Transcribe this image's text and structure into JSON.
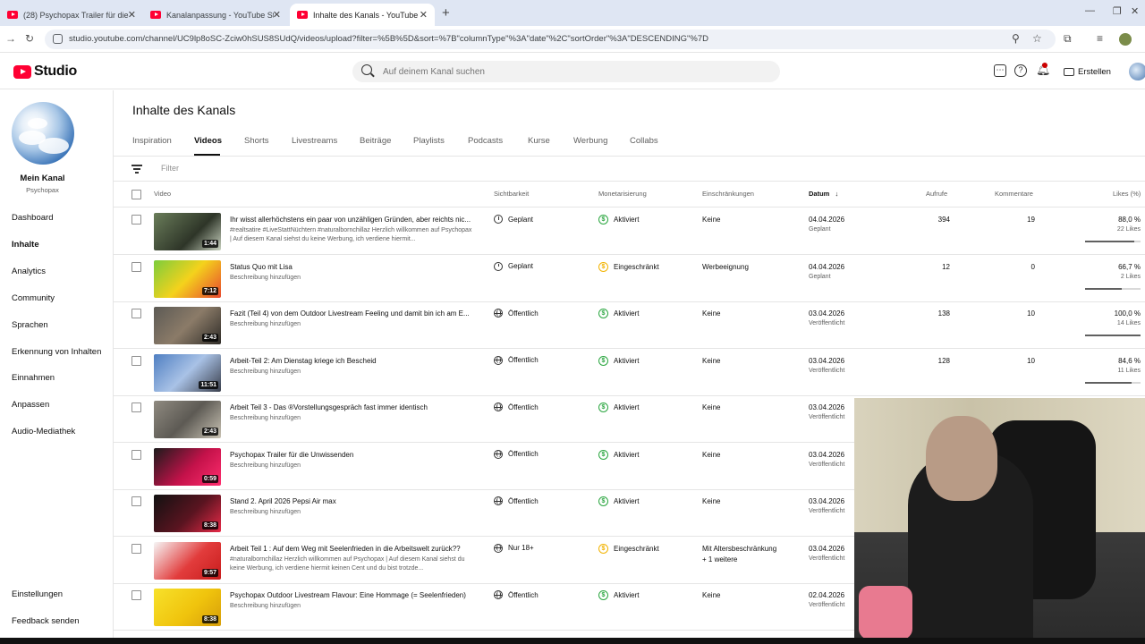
{
  "browser": {
    "tabs": [
      {
        "title": "(28) Psychopax Trailer für die U"
      },
      {
        "title": "Kanalanpassung - YouTube Stu"
      },
      {
        "title": "Inhalte des Kanals - YouTube St"
      }
    ],
    "url": "studio.youtube.com/channel/UC9lp8oSC-Zciw0hSUS8SUdQ/videos/upload?filter=%5B%5D&sort=%7B\"columnType\"%3A\"date\"%2C\"sortOrder\"%3A\"DESCENDING\"%7D"
  },
  "header": {
    "logo_text": "Studio",
    "search_placeholder": "Auf deinem Kanal suchen",
    "create_label": "Erstellen"
  },
  "sidebar": {
    "channel_name": "Mein Kanal",
    "channel_handle": "Psychopax",
    "items": [
      {
        "label": "Dashboard"
      },
      {
        "label": "Inhalte"
      },
      {
        "label": "Analytics"
      },
      {
        "label": "Community"
      },
      {
        "label": "Sprachen"
      },
      {
        "label": "Erkennung von Inhalten"
      },
      {
        "label": "Einnahmen"
      },
      {
        "label": "Anpassen"
      },
      {
        "label": "Audio-Mediathek"
      }
    ],
    "bottom_items": [
      {
        "label": "Einstellungen"
      },
      {
        "label": "Feedback senden"
      }
    ]
  },
  "main": {
    "title": "Inhalte des Kanals",
    "tabs": [
      {
        "label": "Inspiration"
      },
      {
        "label": "Videos"
      },
      {
        "label": "Shorts"
      },
      {
        "label": "Livestreams"
      },
      {
        "label": "Beiträge"
      },
      {
        "label": "Playlists"
      },
      {
        "label": "Podcasts"
      },
      {
        "label": "Kurse"
      },
      {
        "label": "Werbung"
      },
      {
        "label": "Collabs"
      }
    ],
    "filter_label": "Filter",
    "columns": {
      "video": "Video",
      "visibility": "Sichtbarkeit",
      "monetization": "Monetarisierung",
      "restrictions": "Einschränkungen",
      "date": "Datum",
      "views": "Aufrufe",
      "comments": "Kommentare",
      "likes": "Likes (%)"
    },
    "rows": [
      {
        "title": "Ihr wisst allerhöchstens ein paar von unzähligen Gründen, aber reichts nic...",
        "desc": "#realtsatire #LiveStattNüchtern #naturalbornchillaz Herzlich willkommen auf Psychopax | Auf diesem Kanal siehst du keine Werbung, ich verdiene hiermit...",
        "duration": "1:44",
        "visibility": "Geplant",
        "monetization": "Aktiviert",
        "restrictions": "Keine",
        "restrictions2": "",
        "date": "04.04.2026",
        "date_status": "Geplant",
        "views": "394",
        "comments": "19",
        "likes": "88,0 %",
        "likes_count": "22 Likes"
      },
      {
        "title": "Status Quo mit Lisa",
        "desc": "Beschreibung hinzufügen",
        "duration": "7:12",
        "visibility": "Geplant",
        "monetization": "Eingeschränkt",
        "restrictions": "Werbeeignung",
        "restrictions2": "",
        "date": "04.04.2026",
        "date_status": "Geplant",
        "views": "12",
        "comments": "0",
        "likes": "66,7 %",
        "likes_count": "2 Likes"
      },
      {
        "title": "Fazit (Teil 4) von dem Outdoor Livestream Feeling und damit bin ich am E...",
        "desc": "Beschreibung hinzufügen",
        "duration": "2:43",
        "visibility": "Öffentlich",
        "monetization": "Aktiviert",
        "restrictions": "Keine",
        "restrictions2": "",
        "date": "03.04.2026",
        "date_status": "Veröffentlicht",
        "views": "138",
        "comments": "10",
        "likes": "100,0 %",
        "likes_count": "14 Likes"
      },
      {
        "title": "Arbeit-Teil 2: Am Dienstag kriege ich Bescheid",
        "desc": "Beschreibung hinzufügen",
        "duration": "11:51",
        "visibility": "Öffentlich",
        "monetization": "Aktiviert",
        "restrictions": "Keine",
        "restrictions2": "",
        "date": "03.04.2026",
        "date_status": "Veröffentlicht",
        "views": "128",
        "comments": "10",
        "likes": "84,6 %",
        "likes_count": "11 Likes"
      },
      {
        "title": "Arbeit Teil 3 - Das ®Vorstellungsgespräch fast immer identisch",
        "desc": "Beschreibung hinzufügen",
        "duration": "2:43",
        "visibility": "Öffentlich",
        "monetization": "Aktiviert",
        "restrictions": "Keine",
        "restrictions2": "",
        "date": "03.04.2026",
        "date_status": "Veröffentlicht",
        "views": "",
        "comments": "",
        "likes": "",
        "likes_count": ""
      },
      {
        "title": "Psychopax Trailer für die Unwissenden",
        "desc": "Beschreibung hinzufügen",
        "duration": "0:59",
        "visibility": "Öffentlich",
        "monetization": "Aktiviert",
        "restrictions": "Keine",
        "restrictions2": "",
        "date": "03.04.2026",
        "date_status": "Veröffentlicht",
        "views": "",
        "comments": "",
        "likes": "",
        "likes_count": ""
      },
      {
        "title": "Stand 2. April 2026 Pepsi Air max",
        "desc": "Beschreibung hinzufügen",
        "duration": "8:38",
        "visibility": "Öffentlich",
        "monetization": "Aktiviert",
        "restrictions": "Keine",
        "restrictions2": "",
        "date": "03.04.2026",
        "date_status": "Veröffentlicht",
        "views": "",
        "comments": "",
        "likes": "",
        "likes_count": ""
      },
      {
        "title": "Arbeit Teil 1 : Auf dem Weg mit Seelenfrieden in die Arbeitswelt zurück??",
        "desc": "#naturalbornchillaz Herzlich willkommen auf Psychopax | Auf diesem Kanal siehst du keine Werbung, ich verdiene hiermit keinen Cent und du bist trotzde...",
        "duration": "9:57",
        "visibility": "Nur 18+",
        "monetization": "Eingeschränkt",
        "restrictions": "Mit Altersbeschränkung",
        "restrictions2": "+ 1 weitere",
        "date": "03.04.2026",
        "date_status": "Veröffentlicht",
        "views": "",
        "comments": "",
        "likes": "",
        "likes_count": ""
      },
      {
        "title": "Psychopax Outdoor Livestream Flavour: Eine Hommage (= Seelenfrieden)",
        "desc": "Beschreibung hinzufügen",
        "duration": "8:38",
        "visibility": "Öffentlich",
        "monetization": "Aktiviert",
        "restrictions": "Keine",
        "restrictions2": "",
        "date": "02.04.2026",
        "date_status": "Veröffentlicht",
        "views": "",
        "comments": "",
        "likes": "",
        "likes_count": ""
      }
    ],
    "likes_fraction": [
      0.88,
      0.667,
      1.0,
      0.846
    ]
  },
  "colors": {
    "brand_red": "#ff0033",
    "monetization_on": "#2ba640",
    "monetization_limited": "#f2b300"
  }
}
